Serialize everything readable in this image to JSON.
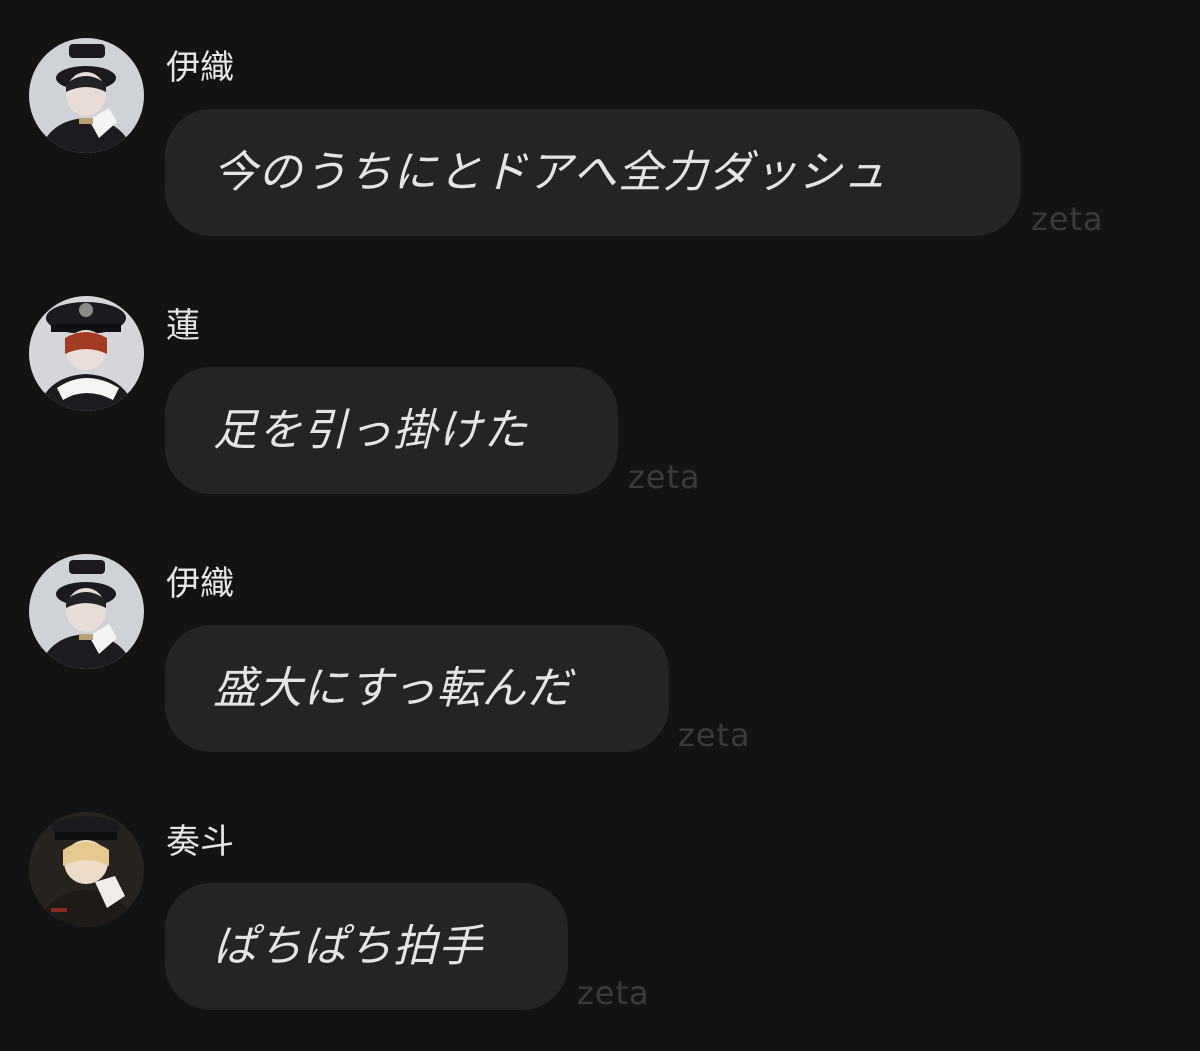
{
  "messages": [
    {
      "sender": "伊織",
      "text": "今のうちにとドアへ全力ダッシュ",
      "avatar": "avatar-iori",
      "watermark": "zeta"
    },
    {
      "sender": "蓮",
      "text": "足を引っ掛けた",
      "avatar": "avatar-ren",
      "watermark": "zeta"
    },
    {
      "sender": "伊織",
      "text": "盛大にすっ転んだ",
      "avatar": "avatar-iori",
      "watermark": "zeta"
    },
    {
      "sender": "奏斗",
      "text": "ぱちぱち拍手",
      "avatar": "avatar-kanato",
      "watermark": "zeta"
    }
  ],
  "colors": {
    "background": "#131313",
    "bubble": "#242424",
    "text": "#e4e4e4",
    "watermark": "#3a3a3a"
  }
}
